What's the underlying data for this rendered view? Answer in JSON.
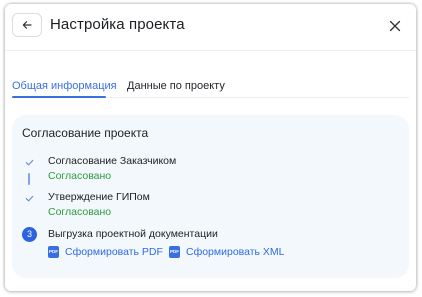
{
  "header": {
    "title": "Настройка проекта"
  },
  "tabs": [
    {
      "label": "Общая информация",
      "active": true
    },
    {
      "label": "Данные по проекту",
      "active": false
    }
  ],
  "approval": {
    "title": "Согласование проекта",
    "steps": [
      {
        "state": "done",
        "label": "Согласование Заказчиком",
        "status": "Согласовано"
      },
      {
        "state": "done",
        "label": "Утверждение ГИПом",
        "status": "Согласовано"
      },
      {
        "state": "current",
        "number": "3",
        "label": "Выгрузка проектной документации"
      }
    ],
    "actions": [
      {
        "icon": "PDF",
        "label": "Сформировать PDF"
      },
      {
        "icon": "PDF",
        "label": "Сформировать XML"
      }
    ]
  },
  "colors": {
    "accent": "#3a6fe0",
    "success": "#2e9a3d",
    "card_bg": "#f3f8fd"
  }
}
